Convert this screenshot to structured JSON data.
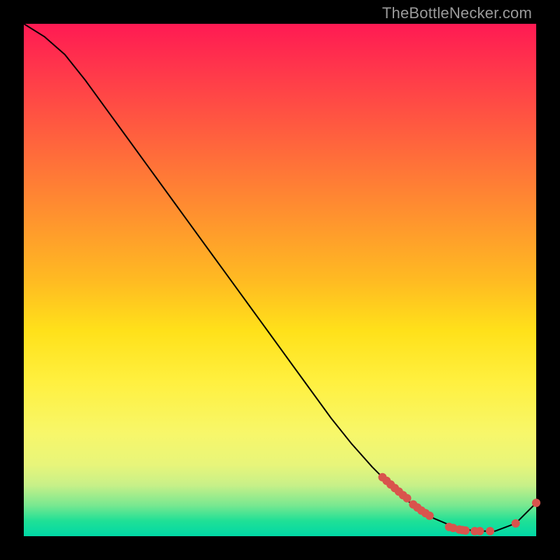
{
  "watermark": "TheBottleNecker.com",
  "chart_data": {
    "type": "line",
    "title": "",
    "xlabel": "",
    "ylabel": "",
    "xlim": [
      0,
      100
    ],
    "ylim": [
      0,
      100
    ],
    "grid": false,
    "series": [
      {
        "name": "bottleneck-curve",
        "x": [
          0,
          4,
          8,
          12,
          16,
          20,
          24,
          28,
          32,
          36,
          40,
          44,
          48,
          52,
          56,
          60,
          64,
          68,
          72,
          76,
          80,
          84,
          88,
          92,
          96,
          100
        ],
        "y": [
          100,
          97.5,
          94,
          89,
          83.5,
          78,
          72.5,
          67,
          61.5,
          56,
          50.5,
          45,
          39.5,
          34,
          28.5,
          23,
          18,
          13.5,
          9.5,
          6,
          3.5,
          1.8,
          1.0,
          1.0,
          2.5,
          6.5
        ],
        "stroke": "#000000",
        "stroke_width": 2
      }
    ],
    "markers": [
      {
        "name": "cluster-dots",
        "x": [
          70.0,
          70.8,
          71.6,
          72.4,
          73.2,
          74.0,
          74.8,
          76.0,
          76.8,
          77.6,
          78.4,
          79.2,
          83.0,
          83.8,
          85.0,
          85.6,
          86.2,
          88.0,
          89.0,
          91.0,
          96.0,
          100.0
        ],
        "y": [
          11.5,
          10.8,
          10.1,
          9.4,
          8.7,
          8.0,
          7.4,
          6.2,
          5.6,
          5.0,
          4.5,
          4.0,
          1.8,
          1.6,
          1.3,
          1.2,
          1.1,
          1.0,
          1.0,
          1.0,
          2.5,
          6.5
        ],
        "color": "#d9544d",
        "radius": 6
      }
    ],
    "colors": {
      "gradient_top": "#ff1a53",
      "gradient_mid": "#ffe11a",
      "gradient_bottom": "#00d8a6",
      "marker": "#d9544d",
      "curve": "#000000",
      "background": "#000000",
      "watermark": "#9a9a9a"
    }
  }
}
